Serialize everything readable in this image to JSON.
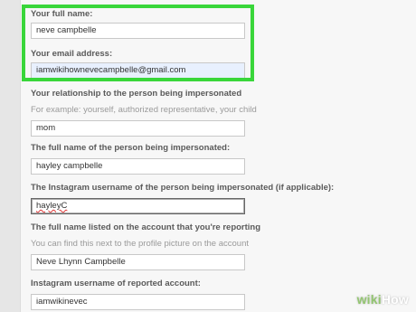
{
  "form": {
    "full_name": {
      "label": "Your full name:",
      "value": "neve campbelle"
    },
    "email": {
      "label": "Your email address:",
      "value": "iamwikihownevecampbelle@gmail.com"
    },
    "relationship": {
      "label": "Your relationship to the person being impersonated",
      "hint": "For example: yourself, authorized representative, your child",
      "value": "mom"
    },
    "impersonated_name": {
      "label": "The full name of the person being impersonated:",
      "value": "hayley campbelle"
    },
    "impersonated_instagram": {
      "label": "The Instagram username of the person being impersonated (if applicable):",
      "value": "hayleyC"
    },
    "reported_name": {
      "label": "The full name listed on the account that you're reporting",
      "hint": "You can find this next to the profile picture on the account",
      "value": "Neve Lhynn Campbelle"
    },
    "reported_instagram": {
      "label": "Instagram username of reported account:",
      "value": "iamwikinevec"
    }
  },
  "watermark": {
    "wiki": "wiki",
    "how": "How"
  },
  "colors": {
    "highlight": "#39d63a",
    "autofill": "#e8f0fe"
  }
}
